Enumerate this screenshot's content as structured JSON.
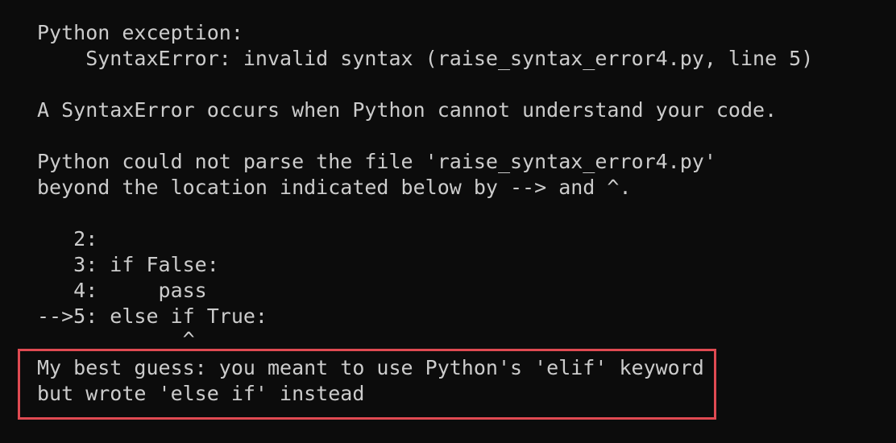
{
  "terminal": {
    "lines": [
      "Python exception:",
      "    SyntaxError: invalid syntax (raise_syntax_error4.py, line 5)",
      "A SyntaxError occurs when Python cannot understand your code.",
      "Python could not parse the file 'raise_syntax_error4.py'",
      "beyond the location indicated below by --> and ^.",
      "   2:",
      "   3: if False:",
      "   4:     pass",
      "-->5: else if True:",
      "            ^",
      "My best guess: you meant to use Python's 'elif' keyword",
      "but wrote 'else if' instead"
    ],
    "highlight_color": "#e04a52",
    "background_color": "#0c0c0c",
    "text_color": "#cccccc"
  }
}
